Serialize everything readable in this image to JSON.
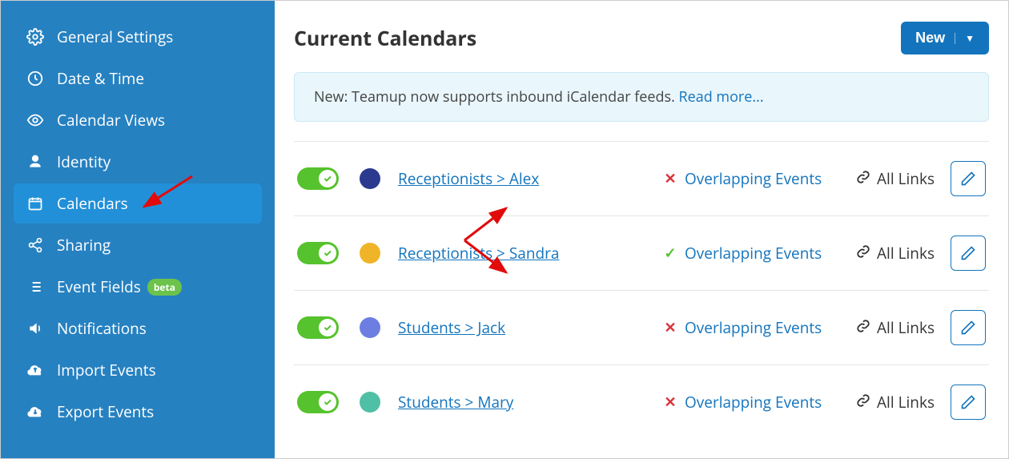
{
  "sidebar": {
    "items": [
      {
        "label": "General Settings"
      },
      {
        "label": "Date & Time"
      },
      {
        "label": "Calendar Views"
      },
      {
        "label": "Identity"
      },
      {
        "label": "Calendars"
      },
      {
        "label": "Sharing"
      },
      {
        "label": "Event Fields",
        "badge": "beta"
      },
      {
        "label": "Notifications"
      },
      {
        "label": "Import Events"
      },
      {
        "label": "Export Events"
      }
    ]
  },
  "header": {
    "title": "Current Calendars",
    "new_label": "New"
  },
  "notice": {
    "text": "New: Teamup now supports inbound iCalendar feeds. ",
    "link": "Read more..."
  },
  "overlap_label": "Overlapping Events",
  "links_label": "All Links",
  "calendars": [
    {
      "name": "Receptionists > Alex",
      "color": "#2a3b8f",
      "overlap": false
    },
    {
      "name": "Receptionists > Sandra",
      "color": "#f0b429",
      "overlap": true
    },
    {
      "name": "Students > Jack",
      "color": "#6c7ee1",
      "overlap": false
    },
    {
      "name": "Students > Mary",
      "color": "#4fbfa5",
      "overlap": false
    }
  ]
}
